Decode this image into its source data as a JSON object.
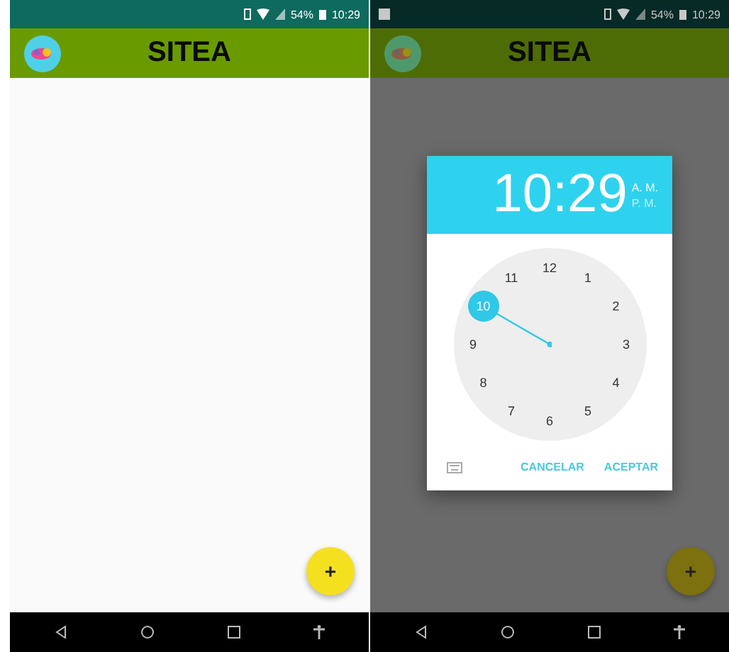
{
  "screens": [
    {
      "dimmed": false,
      "status_bar": {
        "notification": false,
        "battery": "54%",
        "time": "10:29"
      },
      "app_bar": {
        "title": "SITEA"
      },
      "fab": {
        "label": "+"
      }
    },
    {
      "dimmed": true,
      "status_bar": {
        "notification": true,
        "battery": "54%",
        "time": "10:29"
      },
      "app_bar": {
        "title": "SITEA"
      },
      "fab": {
        "label": "+"
      },
      "time_picker": {
        "time": "10:29",
        "periods": [
          {
            "label": "A. M.",
            "selected": true
          },
          {
            "label": "P. M.",
            "selected": false
          }
        ],
        "dial": [
          {
            "label": "12",
            "selected": false
          },
          {
            "label": "1",
            "selected": false
          },
          {
            "label": "2",
            "selected": false
          },
          {
            "label": "3",
            "selected": false
          },
          {
            "label": "4",
            "selected": false
          },
          {
            "label": "5",
            "selected": false
          },
          {
            "label": "6",
            "selected": false
          },
          {
            "label": "7",
            "selected": false
          },
          {
            "label": "8",
            "selected": false
          },
          {
            "label": "9",
            "selected": false
          },
          {
            "label": "10",
            "selected": true
          },
          {
            "label": "11",
            "selected": false
          }
        ],
        "buttons": [
          "CANCELAR",
          "ACEPTAR"
        ]
      }
    }
  ]
}
